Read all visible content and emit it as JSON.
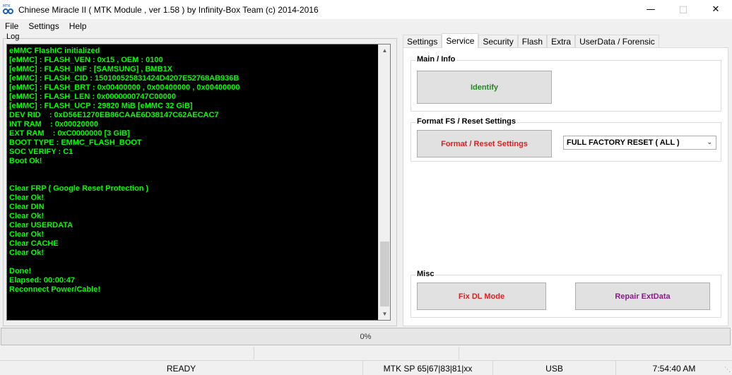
{
  "window": {
    "title": "Chinese Miracle II ( MTK Module , ver 1.58 ) by Infinity-Box Team (c) 2014-2016",
    "icon_tag": "MTK"
  },
  "menu": [
    "File",
    "Settings",
    "Help"
  ],
  "log": {
    "label": "Log",
    "text_color": "#00ff00",
    "lines": [
      "eMMC FlashIC initialized",
      "[eMMC] : FLASH_VEN : 0x15 , OEM : 0100",
      "[eMMC] : FLASH_INF : [SAMSUNG] , BMB1X",
      "[eMMC] : FLASH_CID : 150100525831424D4207E52768AB936B",
      "[eMMC] : FLASH_BRT : 0x00400000 , 0x00400000 , 0x00400000",
      "[eMMC] : FLASH_LEN : 0x0000000747C00000",
      "[eMMC] : FLASH_UCP : 29820 MiB [eMMC 32 GiB]",
      "DEV RID    : 0xD56E1270EB86CAAE6D38147C62AECAC7",
      "INT RAM    : 0x00020000",
      "EXT RAM    : 0xC0000000 [3 GiB]",
      "BOOT TYPE : EMMC_FLASH_BOOT",
      "SOC VERIFY : C1",
      "Boot Ok!",
      "",
      "",
      "Clear FRP ( Google Reset Protection )",
      "Clear Ok!",
      "Clear DIN",
      "Clear Ok!",
      "Clear USERDATA",
      "Clear Ok!",
      "Clear CACHE",
      "Clear Ok!",
      "",
      "Done!",
      "Elapsed: 00:00:47",
      "Reconnect Power/Cable!"
    ]
  },
  "tabs": [
    {
      "label": "Settings",
      "active": false
    },
    {
      "label": "Service",
      "active": true
    },
    {
      "label": "Security",
      "active": false
    },
    {
      "label": "Flash",
      "active": false
    },
    {
      "label": "Extra",
      "active": false
    },
    {
      "label": "UserData / Forensic",
      "active": false
    }
  ],
  "service": {
    "main_info": {
      "title": "Main / Info",
      "identify_label": "Identify"
    },
    "format": {
      "title": "Format FS / Reset Settings",
      "button_label": "Format / Reset Settings",
      "dropdown_value": "FULL FACTORY RESET ( ALL )"
    },
    "misc": {
      "title": "Misc",
      "fix_dl_label": "Fix DL Mode",
      "repair_label": "Repair ExtData"
    }
  },
  "progress": {
    "text": "0%",
    "value": 0
  },
  "status": {
    "state": "READY",
    "platform": "MTK SP 65|67|83|81|xx",
    "connection": "USB",
    "time": "7:54:40 AM"
  },
  "colors": {
    "log_bg": "#000000",
    "log_text": "#00ff00",
    "identify": "#1f8a1f",
    "format": "#e02020",
    "repair": "#8b1a8b"
  }
}
